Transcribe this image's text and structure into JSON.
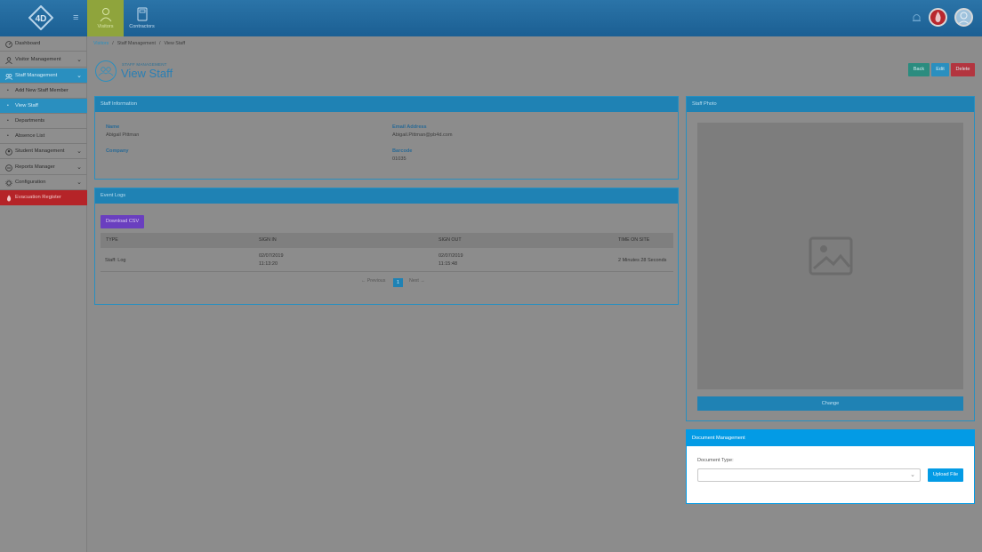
{
  "topbar": {
    "tabs": [
      {
        "label": "Visitors",
        "icon": "person-icon"
      },
      {
        "label": "Contractors",
        "icon": "document-icon"
      }
    ]
  },
  "sidebar": {
    "items": [
      {
        "label": "Dashboard",
        "icon": "dashboard-icon"
      },
      {
        "label": "Visitor Management",
        "icon": "person-icon"
      },
      {
        "label": "Staff Management",
        "icon": "staff-icon"
      },
      {
        "label": "Add New Staff Member"
      },
      {
        "label": "View Staff"
      },
      {
        "label": "Departments"
      },
      {
        "label": "Absence List"
      },
      {
        "label": "Student Management",
        "icon": "student-icon"
      },
      {
        "label": "Reports Manager",
        "icon": "reports-icon"
      },
      {
        "label": "Configuration",
        "icon": "gear-icon"
      },
      {
        "label": "Evacuation Register",
        "icon": "fire-icon"
      }
    ]
  },
  "breadcrumb": [
    "Visitors",
    "Staff Management",
    "View Staff"
  ],
  "page": {
    "section": "STAFF MANAGEMENT",
    "title": "View Staff",
    "actions": {
      "back": "Back",
      "edit": "Edit",
      "delete": "Delete"
    },
    "colors": {
      "back": "#2b8c7f",
      "edit": "#2a8fbf",
      "delete": "#b3353f"
    }
  },
  "staff_info": {
    "heading": "Staff Information",
    "name_label": "Name",
    "name_value": "Abigail Pittman",
    "email_label": "Email Address",
    "email_value": "Abigail.Pittman@pb4d.com",
    "company_label": "Company",
    "company_value": "",
    "barcode_label": "Barcode",
    "barcode_value": "01035"
  },
  "event_logs": {
    "heading": "Event Logs",
    "download_label": "Download CSV",
    "columns": [
      "TYPE",
      "SIGN IN",
      "SIGN OUT",
      "TIME ON SITE"
    ],
    "rows": [
      {
        "type": "Staff: Log",
        "sign_in_date": "02/07/2019",
        "sign_in_time": "11:13:20",
        "sign_out_date": "02/07/2019",
        "sign_out_time": "11:15:48",
        "time_on_site": "2 Minutes 28 Seconds"
      }
    ],
    "pager": {
      "previous": "← Previous",
      "current": "1",
      "next": "Next →"
    }
  },
  "staff_photo": {
    "heading": "Staff Photo",
    "change_label": "Change"
  },
  "document_management": {
    "heading": "Document Management",
    "type_label": "Document Type:",
    "select_value": "",
    "upload_label": "Upload File"
  }
}
